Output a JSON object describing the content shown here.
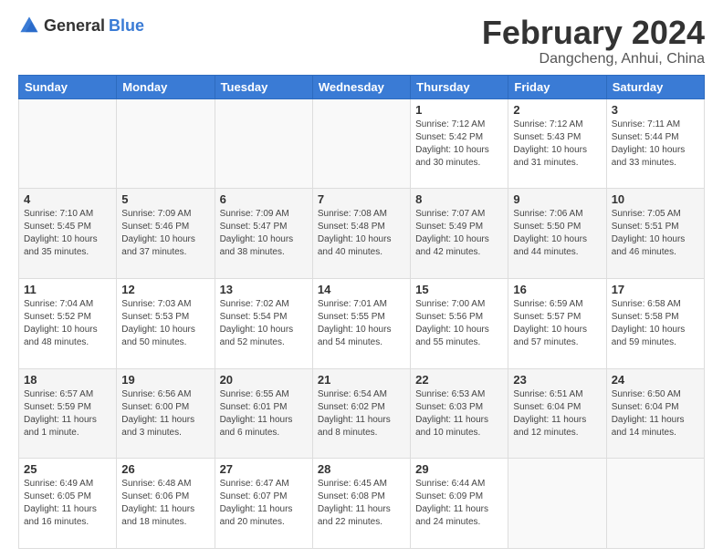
{
  "header": {
    "logo_general": "General",
    "logo_blue": "Blue",
    "month": "February 2024",
    "location": "Dangcheng, Anhui, China"
  },
  "weekdays": [
    "Sunday",
    "Monday",
    "Tuesday",
    "Wednesday",
    "Thursday",
    "Friday",
    "Saturday"
  ],
  "weeks": [
    [
      {
        "day": "",
        "info": ""
      },
      {
        "day": "",
        "info": ""
      },
      {
        "day": "",
        "info": ""
      },
      {
        "day": "",
        "info": ""
      },
      {
        "day": "1",
        "info": "Sunrise: 7:12 AM\nSunset: 5:42 PM\nDaylight: 10 hours\nand 30 minutes."
      },
      {
        "day": "2",
        "info": "Sunrise: 7:12 AM\nSunset: 5:43 PM\nDaylight: 10 hours\nand 31 minutes."
      },
      {
        "day": "3",
        "info": "Sunrise: 7:11 AM\nSunset: 5:44 PM\nDaylight: 10 hours\nand 33 minutes."
      }
    ],
    [
      {
        "day": "4",
        "info": "Sunrise: 7:10 AM\nSunset: 5:45 PM\nDaylight: 10 hours\nand 35 minutes."
      },
      {
        "day": "5",
        "info": "Sunrise: 7:09 AM\nSunset: 5:46 PM\nDaylight: 10 hours\nand 37 minutes."
      },
      {
        "day": "6",
        "info": "Sunrise: 7:09 AM\nSunset: 5:47 PM\nDaylight: 10 hours\nand 38 minutes."
      },
      {
        "day": "7",
        "info": "Sunrise: 7:08 AM\nSunset: 5:48 PM\nDaylight: 10 hours\nand 40 minutes."
      },
      {
        "day": "8",
        "info": "Sunrise: 7:07 AM\nSunset: 5:49 PM\nDaylight: 10 hours\nand 42 minutes."
      },
      {
        "day": "9",
        "info": "Sunrise: 7:06 AM\nSunset: 5:50 PM\nDaylight: 10 hours\nand 44 minutes."
      },
      {
        "day": "10",
        "info": "Sunrise: 7:05 AM\nSunset: 5:51 PM\nDaylight: 10 hours\nand 46 minutes."
      }
    ],
    [
      {
        "day": "11",
        "info": "Sunrise: 7:04 AM\nSunset: 5:52 PM\nDaylight: 10 hours\nand 48 minutes."
      },
      {
        "day": "12",
        "info": "Sunrise: 7:03 AM\nSunset: 5:53 PM\nDaylight: 10 hours\nand 50 minutes."
      },
      {
        "day": "13",
        "info": "Sunrise: 7:02 AM\nSunset: 5:54 PM\nDaylight: 10 hours\nand 52 minutes."
      },
      {
        "day": "14",
        "info": "Sunrise: 7:01 AM\nSunset: 5:55 PM\nDaylight: 10 hours\nand 54 minutes."
      },
      {
        "day": "15",
        "info": "Sunrise: 7:00 AM\nSunset: 5:56 PM\nDaylight: 10 hours\nand 55 minutes."
      },
      {
        "day": "16",
        "info": "Sunrise: 6:59 AM\nSunset: 5:57 PM\nDaylight: 10 hours\nand 57 minutes."
      },
      {
        "day": "17",
        "info": "Sunrise: 6:58 AM\nSunset: 5:58 PM\nDaylight: 10 hours\nand 59 minutes."
      }
    ],
    [
      {
        "day": "18",
        "info": "Sunrise: 6:57 AM\nSunset: 5:59 PM\nDaylight: 11 hours\nand 1 minute."
      },
      {
        "day": "19",
        "info": "Sunrise: 6:56 AM\nSunset: 6:00 PM\nDaylight: 11 hours\nand 3 minutes."
      },
      {
        "day": "20",
        "info": "Sunrise: 6:55 AM\nSunset: 6:01 PM\nDaylight: 11 hours\nand 6 minutes."
      },
      {
        "day": "21",
        "info": "Sunrise: 6:54 AM\nSunset: 6:02 PM\nDaylight: 11 hours\nand 8 minutes."
      },
      {
        "day": "22",
        "info": "Sunrise: 6:53 AM\nSunset: 6:03 PM\nDaylight: 11 hours\nand 10 minutes."
      },
      {
        "day": "23",
        "info": "Sunrise: 6:51 AM\nSunset: 6:04 PM\nDaylight: 11 hours\nand 12 minutes."
      },
      {
        "day": "24",
        "info": "Sunrise: 6:50 AM\nSunset: 6:04 PM\nDaylight: 11 hours\nand 14 minutes."
      }
    ],
    [
      {
        "day": "25",
        "info": "Sunrise: 6:49 AM\nSunset: 6:05 PM\nDaylight: 11 hours\nand 16 minutes."
      },
      {
        "day": "26",
        "info": "Sunrise: 6:48 AM\nSunset: 6:06 PM\nDaylight: 11 hours\nand 18 minutes."
      },
      {
        "day": "27",
        "info": "Sunrise: 6:47 AM\nSunset: 6:07 PM\nDaylight: 11 hours\nand 20 minutes."
      },
      {
        "day": "28",
        "info": "Sunrise: 6:45 AM\nSunset: 6:08 PM\nDaylight: 11 hours\nand 22 minutes."
      },
      {
        "day": "29",
        "info": "Sunrise: 6:44 AM\nSunset: 6:09 PM\nDaylight: 11 hours\nand 24 minutes."
      },
      {
        "day": "",
        "info": ""
      },
      {
        "day": "",
        "info": ""
      }
    ]
  ]
}
